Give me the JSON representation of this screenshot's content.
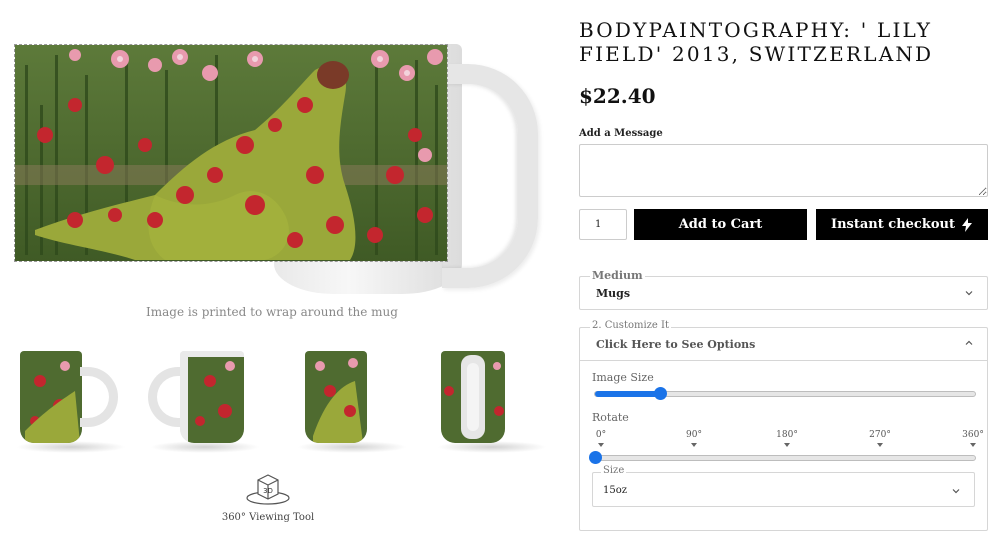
{
  "gallery": {
    "caption": "Image is printed to wrap around the mug",
    "viewer_label": "360° Viewing Tool",
    "viewer_icon_text": "3D"
  },
  "product": {
    "title": "Bodypaintography: ' Lily Field' 2013, Switzerland",
    "price": "$22.40"
  },
  "message": {
    "label": "Add a Message",
    "value": "",
    "placeholder": ""
  },
  "quantity": {
    "value": "1"
  },
  "buttons": {
    "add_to_cart": "Add to Cart",
    "instant_checkout": "Instant checkout"
  },
  "medium": {
    "legend": "Medium",
    "selected": "Mugs"
  },
  "customize": {
    "legend": "2. Customize It",
    "toggle_label": "Click Here to See Options",
    "image_size_label": "Image Size",
    "image_size_value": 0.17,
    "rotate_label": "Rotate",
    "rotate_ticks": [
      "0°",
      "90°",
      "180°",
      "270°",
      "360°"
    ],
    "rotate_value": 0,
    "size_legend": "Size",
    "size_selected": "15oz"
  },
  "colors": {
    "accent": "#1a73e8",
    "button_bg": "#000000",
    "button_text": "#ffffff"
  },
  "icons": [
    "chevron-down-icon",
    "chevron-up-icon",
    "lightning-icon",
    "3d-cube-icon"
  ]
}
